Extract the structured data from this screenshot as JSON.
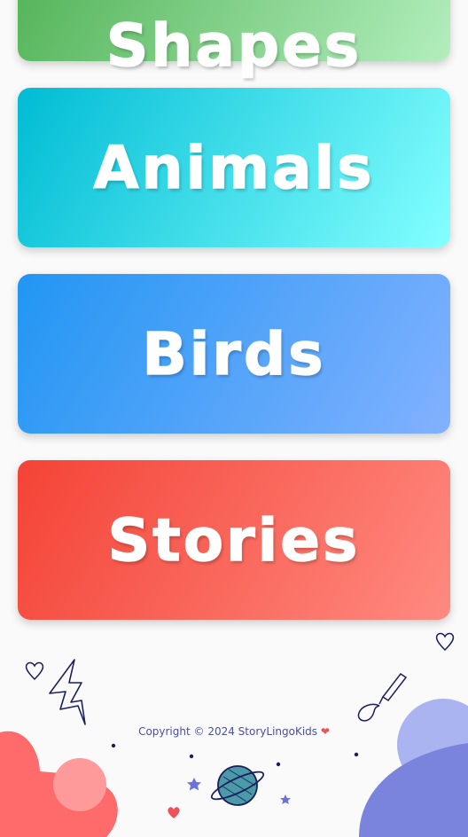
{
  "cards": [
    {
      "label": "Shapes"
    },
    {
      "label": "Animals"
    },
    {
      "label": "Birds"
    },
    {
      "label": "Stories"
    }
  ],
  "footer": {
    "copyright": "Copyright © 2024 StoryLingoKids",
    "heart": "❤",
    "icons": [
      "heart-outline-icon",
      "lightning-icon",
      "pencil-icon",
      "planet-icon",
      "star-icon",
      "blob-decoration"
    ]
  },
  "colors": {
    "shapes": "#4caf50",
    "animals": "#00bcd4",
    "birds": "#2196f3",
    "stories": "#f44336",
    "footer_text": "#4a4f9e"
  }
}
